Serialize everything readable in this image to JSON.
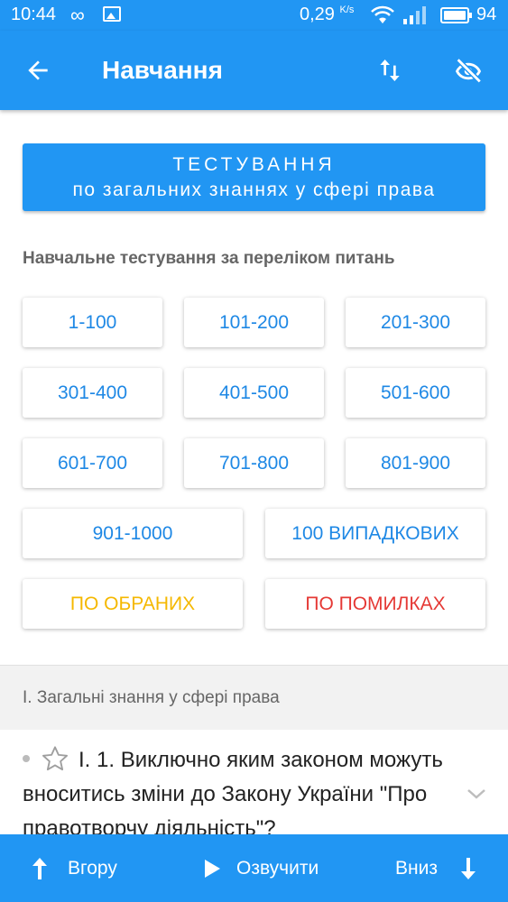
{
  "status_bar": {
    "time": "10:44",
    "speed": "0,29",
    "speed_unit": "K/s",
    "battery": "94"
  },
  "app_bar": {
    "title": "Навчання"
  },
  "test_button": {
    "line1": "ТЕСТУВАННЯ",
    "line2": "по загальних знаннях у сфері права"
  },
  "section_label": "Навчальне тестування за переліком питань",
  "ranges": [
    "1-100",
    "101-200",
    "201-300",
    "301-400",
    "401-500",
    "501-600",
    "601-700",
    "701-800",
    "801-900",
    "901-1000"
  ],
  "random_label": "100 ВИПАДКОВИХ",
  "favorites_label": "ПО ОБРАНИХ",
  "mistakes_label": "ПО ПОМИЛКАХ",
  "group_header": "І. Загальні знання у сфері права",
  "question": {
    "text": "І. 1. Виключно яким законом можуть вноситись зміни до Закону України \"Про правотворчу діяльність\"?"
  },
  "bottom_bar": {
    "up": "Вгору",
    "speak": "Озвучити",
    "down": "Вниз"
  },
  "colors": {
    "primary": "#2196f3",
    "range_text": "#1e88e5",
    "favorites": "#f5b800",
    "mistakes": "#e53935"
  }
}
